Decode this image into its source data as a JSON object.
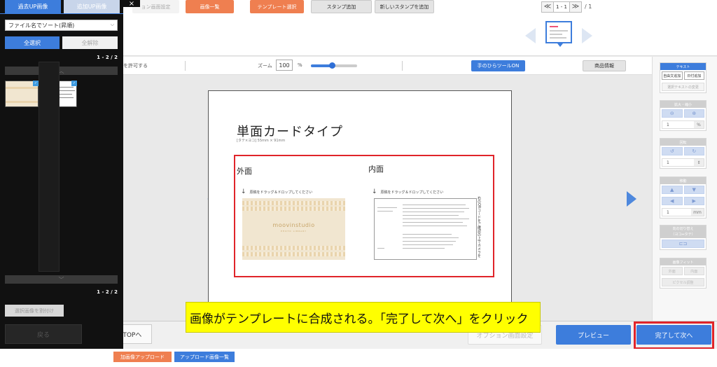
{
  "toolbar": {
    "faded_settings": "ョン画面設定",
    "image_list": "画像一覧",
    "template_select": "テンプレート選択",
    "stamp_add": "スタンプ追加",
    "new_stamp_add": "新しいスタンプを追加",
    "pager_first": "≪",
    "pager_value": "1 - 1",
    "pager_last": "≫",
    "pager_total": "/ 1"
  },
  "options": {
    "allow_text": "を許可する",
    "zoom_label": "ズーム",
    "zoom_value": "100",
    "zoom_unit": "%",
    "zoom_level_percent": 45,
    "hand_tool": "手のひらツールON",
    "product_info": "商品情報"
  },
  "paper": {
    "title": "単面カードタイプ",
    "subtitle": "[タテ×ヨコ] 55mm × 91mm",
    "outer_label": "外面",
    "inner_label": "内面",
    "drop_hint_outer": "原稿をドラッグ＆ドロップしてください",
    "drop_hint_inner": "原稿をドラッグ＆ドロップしてください",
    "card_brand": "moovinstudio",
    "card_brand_sub": "PHOTO LIBRARY",
    "inner_vertical_text": "右のQRコードをご確認の上でカメラをかざしてください"
  },
  "right_panel": {
    "text_head": "テキスト",
    "free_text": "自由文追加",
    "date_add": "日付追加",
    "selected_text_change": "選択テキストの変更",
    "zoom_head": "拡大・縮小",
    "zoom_value": "1",
    "zoom_unit": "%",
    "rotate_head": "回転",
    "rotate_value": "1",
    "move_head": "移動",
    "move_value": "1",
    "move_unit": "mm",
    "switch_head": "向の切り替え\n（ヨコ⇔タテ）",
    "fit_head": "画像フィット",
    "fit_outer": "外面",
    "fit_inner": "内面",
    "fit_pixel": "ピクセル調整"
  },
  "bottom": {
    "back": "戻る",
    "save_top": "保存してTOPへ",
    "option_settings": "オプション画面設定",
    "preview": "プレビュー",
    "finish_next": "完了して次へ"
  },
  "footer": {
    "tab_add_upload": "加画像アップロード",
    "tab_uploaded_list": "アップロード画像一覧"
  },
  "left_panel": {
    "tab_past": "過去UP画像",
    "tab_added": "追加UP画像",
    "sort_label": "ファイル名でソート(昇順)",
    "select_all": "全選択",
    "unselect_all": "全解除",
    "count_top": "1 - 2 / 2",
    "count_bottom": "1 - 2 / 2",
    "bulk_delete": "選択画像を割付け",
    "close": "×"
  },
  "annotation": {
    "text": "画像がテンプレートに合成される。「完了して次へ」をクリック"
  },
  "colors": {
    "accent_blue": "#3d7ddc",
    "accent_orange": "#ef7f50",
    "highlight_red": "#e0242a",
    "annotation_yellow": "#ffff00"
  }
}
